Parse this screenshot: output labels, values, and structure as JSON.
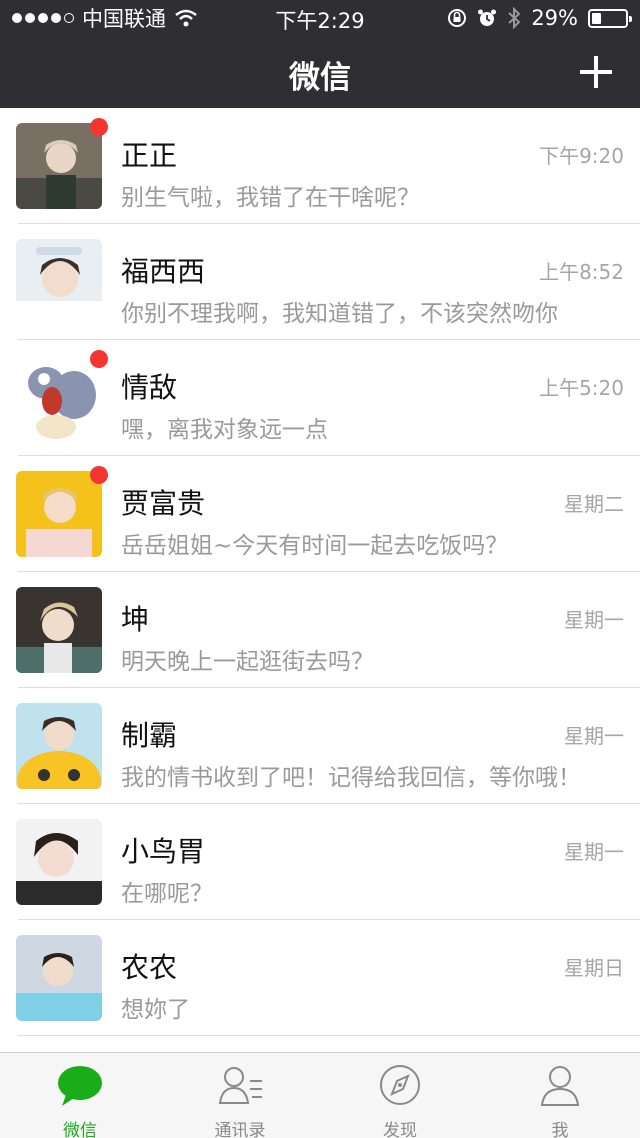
{
  "status_bar": {
    "carrier": "中国联通",
    "time": "下午2:29",
    "battery": "29%",
    "battery_level": 0.29
  },
  "header": {
    "title": "微信"
  },
  "chats": [
    {
      "name": "正正",
      "time": "下午9:20",
      "message": "别生气啦，我错了在干啥呢？",
      "unread": true
    },
    {
      "name": "福西西",
      "time": "上午8:52",
      "message": "你别不理我啊，我知道错了，不该突然吻你",
      "unread": false
    },
    {
      "name": "情敌",
      "time": "上午5:20",
      "message": "嘿，离我对象远一点",
      "unread": true
    },
    {
      "name": "贾富贵",
      "time": "星期二",
      "message": "岳岳姐姐~今天有时间一起去吃饭吗？",
      "unread": true
    },
    {
      "name": "坤",
      "time": "星期一",
      "message": "明天晚上一起逛街去吗？",
      "unread": false
    },
    {
      "name": "制霸",
      "time": "星期一",
      "message": "我的情书收到了吧！记得给我回信，等你哦！",
      "unread": false
    },
    {
      "name": "小鸟胃",
      "time": "星期一",
      "message": "在哪呢？",
      "unread": false
    },
    {
      "name": "农农",
      "time": "星期日",
      "message": "想妳了",
      "unread": false
    }
  ],
  "tabs": [
    {
      "label": "微信",
      "icon": "chat-bubble-icon",
      "active": true
    },
    {
      "label": "通讯录",
      "icon": "contacts-icon",
      "active": false
    },
    {
      "label": "发现",
      "icon": "compass-icon",
      "active": false
    },
    {
      "label": "我",
      "icon": "person-icon",
      "active": false
    }
  ],
  "colors": {
    "header_bg": "#2e2e33",
    "accent_green": "#1aad19",
    "unread_red": "#f43530"
  }
}
